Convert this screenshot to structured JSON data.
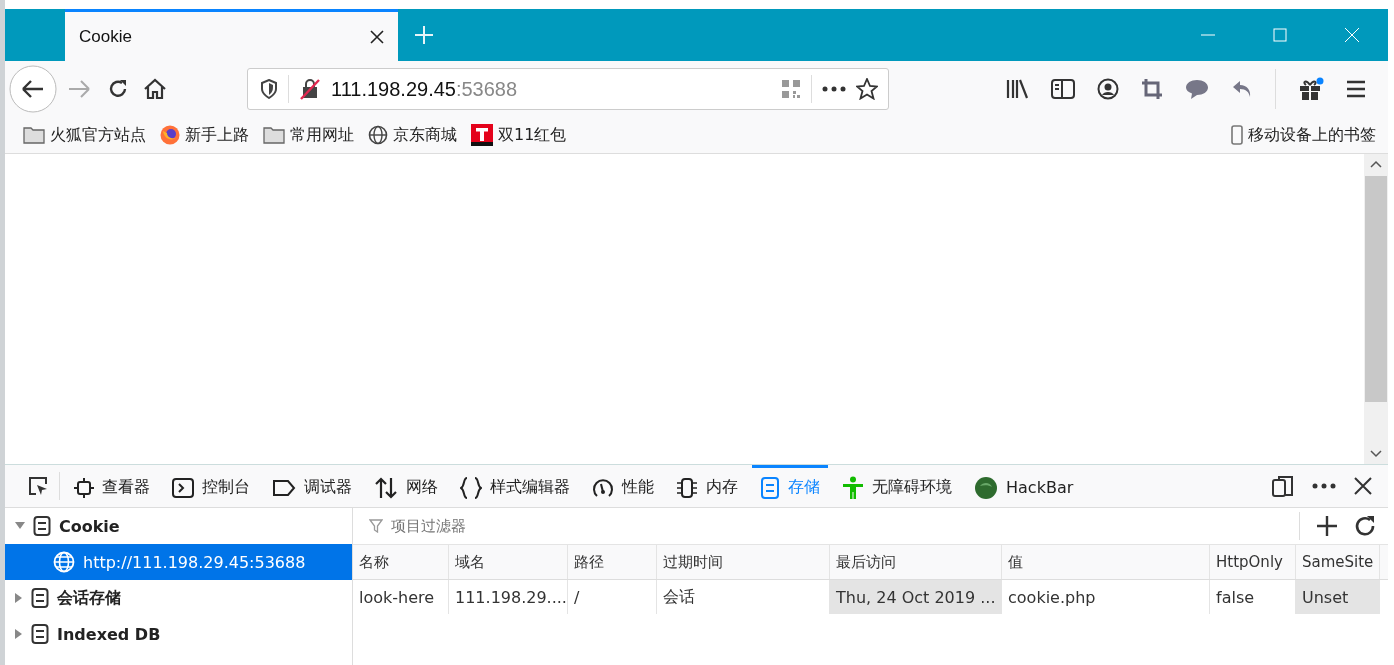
{
  "tabs": [
    {
      "title": "Cookie",
      "selected": true
    }
  ],
  "address_bar": {
    "host": "111.198.29.45",
    "port": ":53688"
  },
  "bookmarks": [
    {
      "label": "火狐官方站点",
      "kind": "folder"
    },
    {
      "label": "新手上路",
      "kind": "firefox"
    },
    {
      "label": "常用网址",
      "kind": "folder"
    },
    {
      "label": "京东商城",
      "kind": "globe"
    },
    {
      "label": "双11红包",
      "kind": "t"
    }
  ],
  "mobile_bookmarks": "移动设备上的书签",
  "devtools": {
    "tools": [
      {
        "label": "查看器",
        "kind": "inspector",
        "selected": false
      },
      {
        "label": "控制台",
        "kind": "console",
        "selected": false
      },
      {
        "label": "调试器",
        "kind": "debugger",
        "selected": false
      },
      {
        "label": "网络",
        "kind": "network",
        "selected": false
      },
      {
        "label": "样式编辑器",
        "kind": "style",
        "selected": false
      },
      {
        "label": "性能",
        "kind": "performance",
        "selected": false
      },
      {
        "label": "内存",
        "kind": "memory",
        "selected": false
      },
      {
        "label": "存储",
        "kind": "storage",
        "selected": true
      },
      {
        "label": "无障碍环境",
        "kind": "accessibility",
        "selected": false
      },
      {
        "label": "HackBar",
        "kind": "hackbar",
        "selected": false
      }
    ],
    "tree": [
      {
        "label": "Cookie",
        "expanded": true,
        "selected": false,
        "children": [
          {
            "label": "http://111.198.29.45:53688",
            "selected": true
          }
        ]
      },
      {
        "label": "会话存储",
        "expanded": false,
        "selected": false
      },
      {
        "label": "Indexed DB",
        "expanded": false,
        "selected": false
      }
    ],
    "filter": {
      "placeholder": "项目过滤器"
    },
    "columns": [
      {
        "label": "名称",
        "shaded": false
      },
      {
        "label": "域名",
        "shaded": false
      },
      {
        "label": "路径",
        "shaded": false
      },
      {
        "label": "过期时间",
        "shaded": false
      },
      {
        "label": "最后访问",
        "shaded": true
      },
      {
        "label": "值",
        "shaded": false
      },
      {
        "label": "HttpOnly",
        "shaded": false
      },
      {
        "label": "SameSite",
        "shaded": true
      }
    ],
    "rows": [
      [
        "look-here",
        "111.198.29....",
        "/",
        "会话",
        "Thu, 24 Oct 2019 ...",
        "cookie.php",
        "false",
        "Unset"
      ]
    ]
  }
}
